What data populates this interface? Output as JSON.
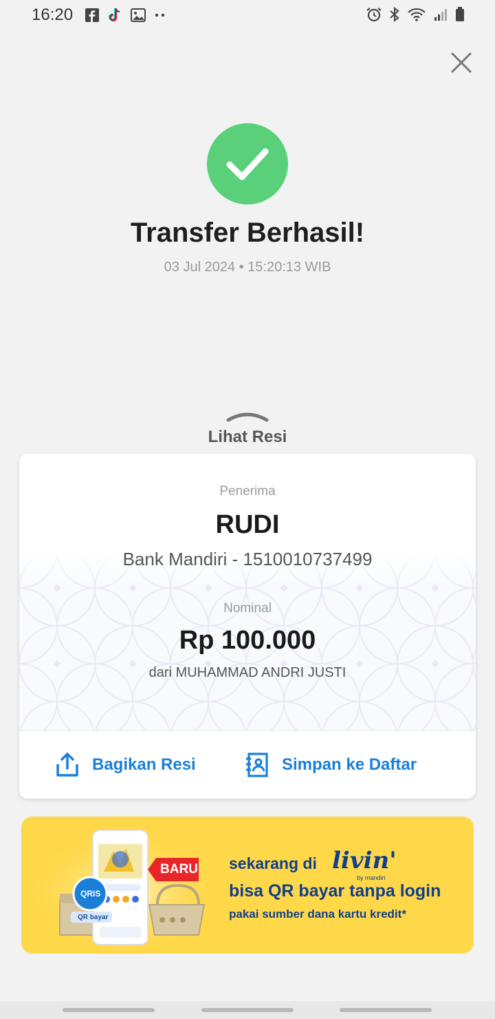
{
  "status_bar": {
    "time": "16:20",
    "left_icons": [
      "facebook-icon",
      "tiktok-icon",
      "gallery-icon",
      "more-dots-icon"
    ],
    "right_icons": [
      "alarm-icon",
      "bluetooth-icon",
      "wifi-icon",
      "signal-icon",
      "battery-icon"
    ]
  },
  "header": {
    "title": "Transfer Berhasil!",
    "datetime": "03 Jul 2024 • 15:20:13 WIB"
  },
  "receipt_toggle": {
    "label": "Lihat Resi"
  },
  "receipt": {
    "recipient_label": "Penerima",
    "recipient_name": "RUDI",
    "recipient_bank": "Bank Mandiri - 1510010737499",
    "amount_label": "Nominal",
    "amount": "Rp 100.000",
    "from": "dari MUHAMMAD ANDRI JUSTI"
  },
  "actions": {
    "share_label": "Bagikan Resi",
    "save_label": "Simpan ke Daftar"
  },
  "banner": {
    "line1": "sekarang di",
    "brand": "livin'",
    "brand_sub": "by mandiri",
    "line2": "bisa QR bayar tanpa login",
    "line3": "pakai sumber dana kartu kredit*",
    "badge": "BARU",
    "qris_label": "QRIS",
    "qr_button": "QR bayar"
  },
  "colors": {
    "success": "#5ad07a",
    "accent_blue": "#1b7fd8",
    "banner_yellow": "#ffd84a",
    "banner_text": "#123f8a",
    "badge_red": "#e8262a"
  }
}
